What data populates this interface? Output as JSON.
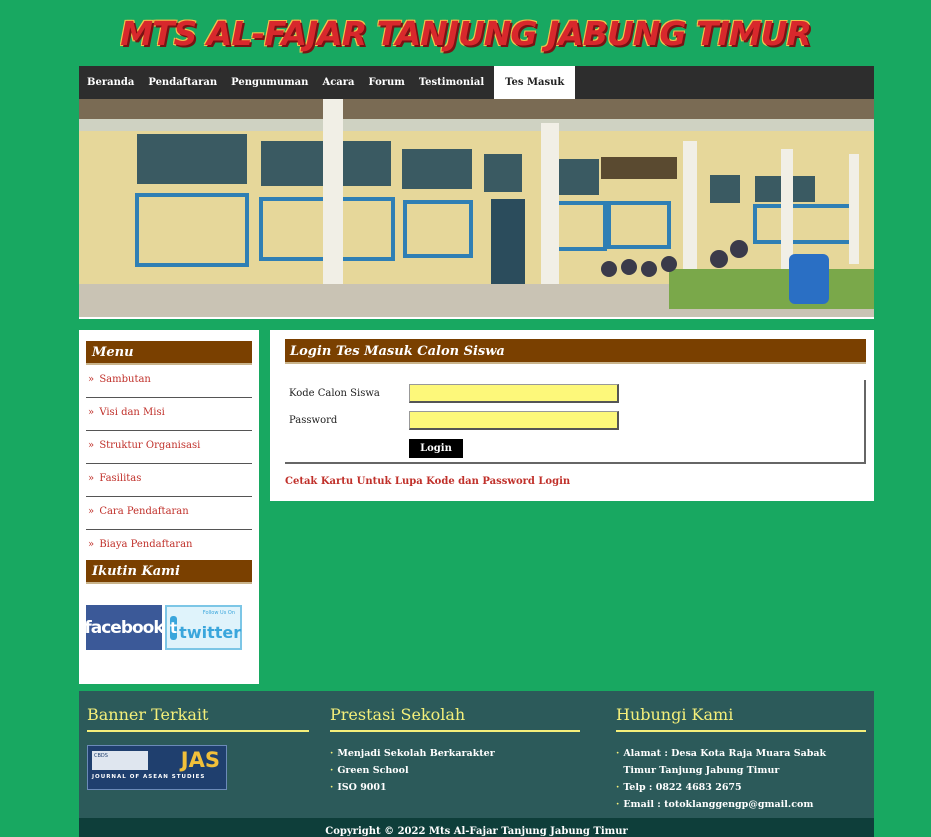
{
  "site": {
    "title": "MTS AL-FAJAR TANJUNG JABUNG TIMUR"
  },
  "nav": {
    "items": [
      "Beranda",
      "Pendaftaran",
      "Pengumuman",
      "Acara",
      "Forum",
      "Testimonial",
      "Tes Masuk"
    ],
    "active": "Tes Masuk"
  },
  "sidebar": {
    "menu_title": "Menu",
    "menu_items": [
      "Sambutan",
      "Visi dan Misi",
      "Struktur Organisasi",
      "Fasilitas",
      "Cara Pendaftaran",
      "Biaya Pendaftaran"
    ],
    "follow_title": "Ikutin Kami",
    "facebook_label": "facebook",
    "twitter_label": "twitter",
    "twitter_small": "Follow Us On"
  },
  "main": {
    "title": "Login Tes Masuk Calon Siswa",
    "fields": [
      {
        "label": "Kode Calon Siswa",
        "value": "",
        "type": "text"
      },
      {
        "label": "Password",
        "value": "",
        "type": "password"
      }
    ],
    "login_button": "Login",
    "forgot_link": "Cetak Kartu Untuk Lupa Kode dan Password Login"
  },
  "footer": {
    "banner_title": "Banner Terkait",
    "banner": {
      "abbr": "JAS",
      "subtitle": "JOURNAL OF ASEAN STUDIES",
      "logo_text": "CBDS"
    },
    "prestasi_title": "Prestasi Sekolah",
    "prestasi_items": [
      "Menjadi Sekolah Berkarakter",
      "Green School",
      "ISO 9001"
    ],
    "contact_title": "Hubungi Kami",
    "contact_items": [
      "Alamat : Desa Kota Raja Muara Sabak Timur Tanjung Jabung Timur",
      "Telp : 0822 4683 2675",
      "Email : totoklanggengp@gmail.com"
    ]
  },
  "copyright": "Copyright © 2022 Mts Al-Fajar Tanjung Jabung Timur",
  "colors": {
    "background": "#18a861",
    "heading_brown": "#7a4000",
    "footer": "#2c5a5a",
    "link_red": "#c0302a",
    "input_yellow": "#fdf87a",
    "footer_heading": "#f4ef7a"
  }
}
